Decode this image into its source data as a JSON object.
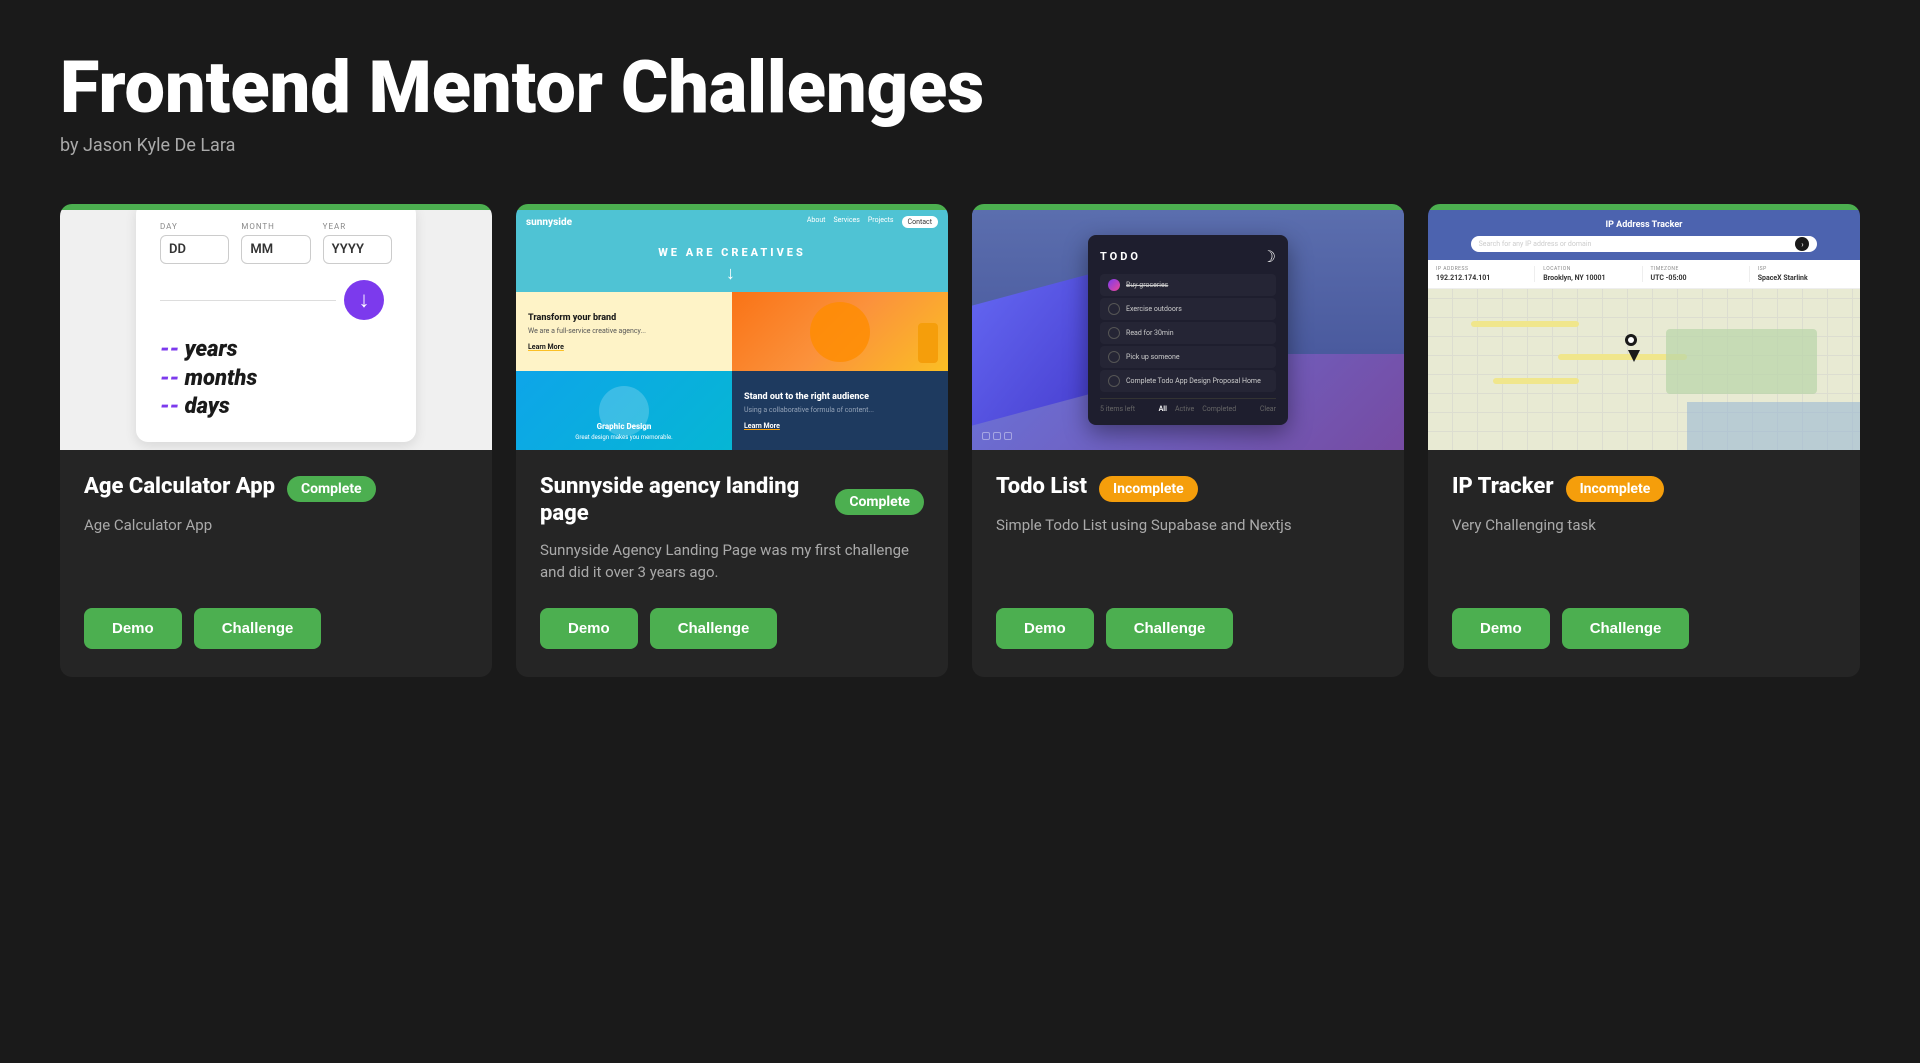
{
  "header": {
    "title": "Frontend Mentor Challenges",
    "subtitle": "by Jason Kyle De Lara"
  },
  "cards": [
    {
      "id": "age-calculator",
      "title": "Age Calculator App",
      "badge": "Complete",
      "badge_type": "complete",
      "description": "Age Calculator App",
      "demo_label": "Demo",
      "challenge_label": "Challenge"
    },
    {
      "id": "sunnyside",
      "title": "Sunnyside agency landing page",
      "badge": "Complete",
      "badge_type": "complete",
      "description": "Sunnyside Agency Landing Page was my first challenge and did it over 3 years ago.",
      "demo_label": "Demo",
      "challenge_label": "Challenge"
    },
    {
      "id": "todo-list",
      "title": "Todo List",
      "badge": "Incomplete",
      "badge_type": "incomplete",
      "description": "Simple Todo List using Supabase and Nextjs",
      "demo_label": "Demo",
      "challenge_label": "Challenge"
    },
    {
      "id": "ip-tracker",
      "title": "IP Tracker",
      "badge": "Incomplete",
      "badge_type": "incomplete",
      "description": "Very Challenging task",
      "demo_label": "Demo",
      "challenge_label": "Challenge"
    }
  ],
  "mockups": {
    "age_calc": {
      "day_label": "DAY",
      "month_label": "MONTH",
      "year_label": "YEAR",
      "day_placeholder": "DD",
      "month_placeholder": "MM",
      "year_placeholder": "YYYY",
      "years_text": "years",
      "months_text": "months",
      "days_text": "days"
    },
    "sunnyside": {
      "hero_text": "WE ARE CREATIVES",
      "col1_title": "Transform your brand",
      "col2_title": "Stand out to the right audience"
    },
    "todo": {
      "title": "TODO",
      "items": [
        "Buy groceries",
        "Exercise outdoors",
        "Read for 30min",
        "Pick up someone",
        "Complete app design Proposal Home"
      ]
    },
    "ip": {
      "title": "IP Address Tracker",
      "ip_address": "192.212.174.101",
      "location": "Brooklyn, NY 10001",
      "timezone": "UTC -05:00",
      "isp": "SpaceX Starlink"
    }
  }
}
